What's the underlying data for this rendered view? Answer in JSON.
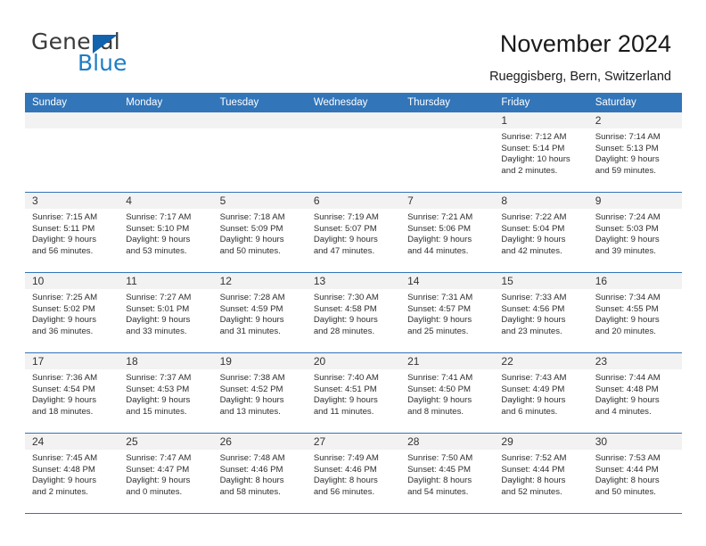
{
  "brand": {
    "name_part1": "General",
    "name_part2": "Blue",
    "triangle_color": "#1263ad",
    "blue_color": "#1d7dc4"
  },
  "header": {
    "title": "November 2024",
    "subtitle": "Rueggisberg, Bern, Switzerland",
    "header_bg": "#3275b9",
    "daynum_bg": "#f2f2f2"
  },
  "weekday_headers": [
    "Sunday",
    "Monday",
    "Tuesday",
    "Wednesday",
    "Thursday",
    "Friday",
    "Saturday"
  ],
  "weeks": [
    [
      {
        "day": "",
        "empty": true
      },
      {
        "day": "",
        "empty": true
      },
      {
        "day": "",
        "empty": true
      },
      {
        "day": "",
        "empty": true
      },
      {
        "day": "",
        "empty": true
      },
      {
        "day": "1",
        "sunrise": "Sunrise: 7:12 AM",
        "sunset": "Sunset: 5:14 PM",
        "daylight1": "Daylight: 10 hours",
        "daylight2": "and 2 minutes."
      },
      {
        "day": "2",
        "sunrise": "Sunrise: 7:14 AM",
        "sunset": "Sunset: 5:13 PM",
        "daylight1": "Daylight: 9 hours",
        "daylight2": "and 59 minutes."
      }
    ],
    [
      {
        "day": "3",
        "sunrise": "Sunrise: 7:15 AM",
        "sunset": "Sunset: 5:11 PM",
        "daylight1": "Daylight: 9 hours",
        "daylight2": "and 56 minutes."
      },
      {
        "day": "4",
        "sunrise": "Sunrise: 7:17 AM",
        "sunset": "Sunset: 5:10 PM",
        "daylight1": "Daylight: 9 hours",
        "daylight2": "and 53 minutes."
      },
      {
        "day": "5",
        "sunrise": "Sunrise: 7:18 AM",
        "sunset": "Sunset: 5:09 PM",
        "daylight1": "Daylight: 9 hours",
        "daylight2": "and 50 minutes."
      },
      {
        "day": "6",
        "sunrise": "Sunrise: 7:19 AM",
        "sunset": "Sunset: 5:07 PM",
        "daylight1": "Daylight: 9 hours",
        "daylight2": "and 47 minutes."
      },
      {
        "day": "7",
        "sunrise": "Sunrise: 7:21 AM",
        "sunset": "Sunset: 5:06 PM",
        "daylight1": "Daylight: 9 hours",
        "daylight2": "and 44 minutes."
      },
      {
        "day": "8",
        "sunrise": "Sunrise: 7:22 AM",
        "sunset": "Sunset: 5:04 PM",
        "daylight1": "Daylight: 9 hours",
        "daylight2": "and 42 minutes."
      },
      {
        "day": "9",
        "sunrise": "Sunrise: 7:24 AM",
        "sunset": "Sunset: 5:03 PM",
        "daylight1": "Daylight: 9 hours",
        "daylight2": "and 39 minutes."
      }
    ],
    [
      {
        "day": "10",
        "sunrise": "Sunrise: 7:25 AM",
        "sunset": "Sunset: 5:02 PM",
        "daylight1": "Daylight: 9 hours",
        "daylight2": "and 36 minutes."
      },
      {
        "day": "11",
        "sunrise": "Sunrise: 7:27 AM",
        "sunset": "Sunset: 5:01 PM",
        "daylight1": "Daylight: 9 hours",
        "daylight2": "and 33 minutes."
      },
      {
        "day": "12",
        "sunrise": "Sunrise: 7:28 AM",
        "sunset": "Sunset: 4:59 PM",
        "daylight1": "Daylight: 9 hours",
        "daylight2": "and 31 minutes."
      },
      {
        "day": "13",
        "sunrise": "Sunrise: 7:30 AM",
        "sunset": "Sunset: 4:58 PM",
        "daylight1": "Daylight: 9 hours",
        "daylight2": "and 28 minutes."
      },
      {
        "day": "14",
        "sunrise": "Sunrise: 7:31 AM",
        "sunset": "Sunset: 4:57 PM",
        "daylight1": "Daylight: 9 hours",
        "daylight2": "and 25 minutes."
      },
      {
        "day": "15",
        "sunrise": "Sunrise: 7:33 AM",
        "sunset": "Sunset: 4:56 PM",
        "daylight1": "Daylight: 9 hours",
        "daylight2": "and 23 minutes."
      },
      {
        "day": "16",
        "sunrise": "Sunrise: 7:34 AM",
        "sunset": "Sunset: 4:55 PM",
        "daylight1": "Daylight: 9 hours",
        "daylight2": "and 20 minutes."
      }
    ],
    [
      {
        "day": "17",
        "sunrise": "Sunrise: 7:36 AM",
        "sunset": "Sunset: 4:54 PM",
        "daylight1": "Daylight: 9 hours",
        "daylight2": "and 18 minutes."
      },
      {
        "day": "18",
        "sunrise": "Sunrise: 7:37 AM",
        "sunset": "Sunset: 4:53 PM",
        "daylight1": "Daylight: 9 hours",
        "daylight2": "and 15 minutes."
      },
      {
        "day": "19",
        "sunrise": "Sunrise: 7:38 AM",
        "sunset": "Sunset: 4:52 PM",
        "daylight1": "Daylight: 9 hours",
        "daylight2": "and 13 minutes."
      },
      {
        "day": "20",
        "sunrise": "Sunrise: 7:40 AM",
        "sunset": "Sunset: 4:51 PM",
        "daylight1": "Daylight: 9 hours",
        "daylight2": "and 11 minutes."
      },
      {
        "day": "21",
        "sunrise": "Sunrise: 7:41 AM",
        "sunset": "Sunset: 4:50 PM",
        "daylight1": "Daylight: 9 hours",
        "daylight2": "and 8 minutes."
      },
      {
        "day": "22",
        "sunrise": "Sunrise: 7:43 AM",
        "sunset": "Sunset: 4:49 PM",
        "daylight1": "Daylight: 9 hours",
        "daylight2": "and 6 minutes."
      },
      {
        "day": "23",
        "sunrise": "Sunrise: 7:44 AM",
        "sunset": "Sunset: 4:48 PM",
        "daylight1": "Daylight: 9 hours",
        "daylight2": "and 4 minutes."
      }
    ],
    [
      {
        "day": "24",
        "sunrise": "Sunrise: 7:45 AM",
        "sunset": "Sunset: 4:48 PM",
        "daylight1": "Daylight: 9 hours",
        "daylight2": "and 2 minutes."
      },
      {
        "day": "25",
        "sunrise": "Sunrise: 7:47 AM",
        "sunset": "Sunset: 4:47 PM",
        "daylight1": "Daylight: 9 hours",
        "daylight2": "and 0 minutes."
      },
      {
        "day": "26",
        "sunrise": "Sunrise: 7:48 AM",
        "sunset": "Sunset: 4:46 PM",
        "daylight1": "Daylight: 8 hours",
        "daylight2": "and 58 minutes."
      },
      {
        "day": "27",
        "sunrise": "Sunrise: 7:49 AM",
        "sunset": "Sunset: 4:46 PM",
        "daylight1": "Daylight: 8 hours",
        "daylight2": "and 56 minutes."
      },
      {
        "day": "28",
        "sunrise": "Sunrise: 7:50 AM",
        "sunset": "Sunset: 4:45 PM",
        "daylight1": "Daylight: 8 hours",
        "daylight2": "and 54 minutes."
      },
      {
        "day": "29",
        "sunrise": "Sunrise: 7:52 AM",
        "sunset": "Sunset: 4:44 PM",
        "daylight1": "Daylight: 8 hours",
        "daylight2": "and 52 minutes."
      },
      {
        "day": "30",
        "sunrise": "Sunrise: 7:53 AM",
        "sunset": "Sunset: 4:44 PM",
        "daylight1": "Daylight: 8 hours",
        "daylight2": "and 50 minutes."
      }
    ]
  ]
}
